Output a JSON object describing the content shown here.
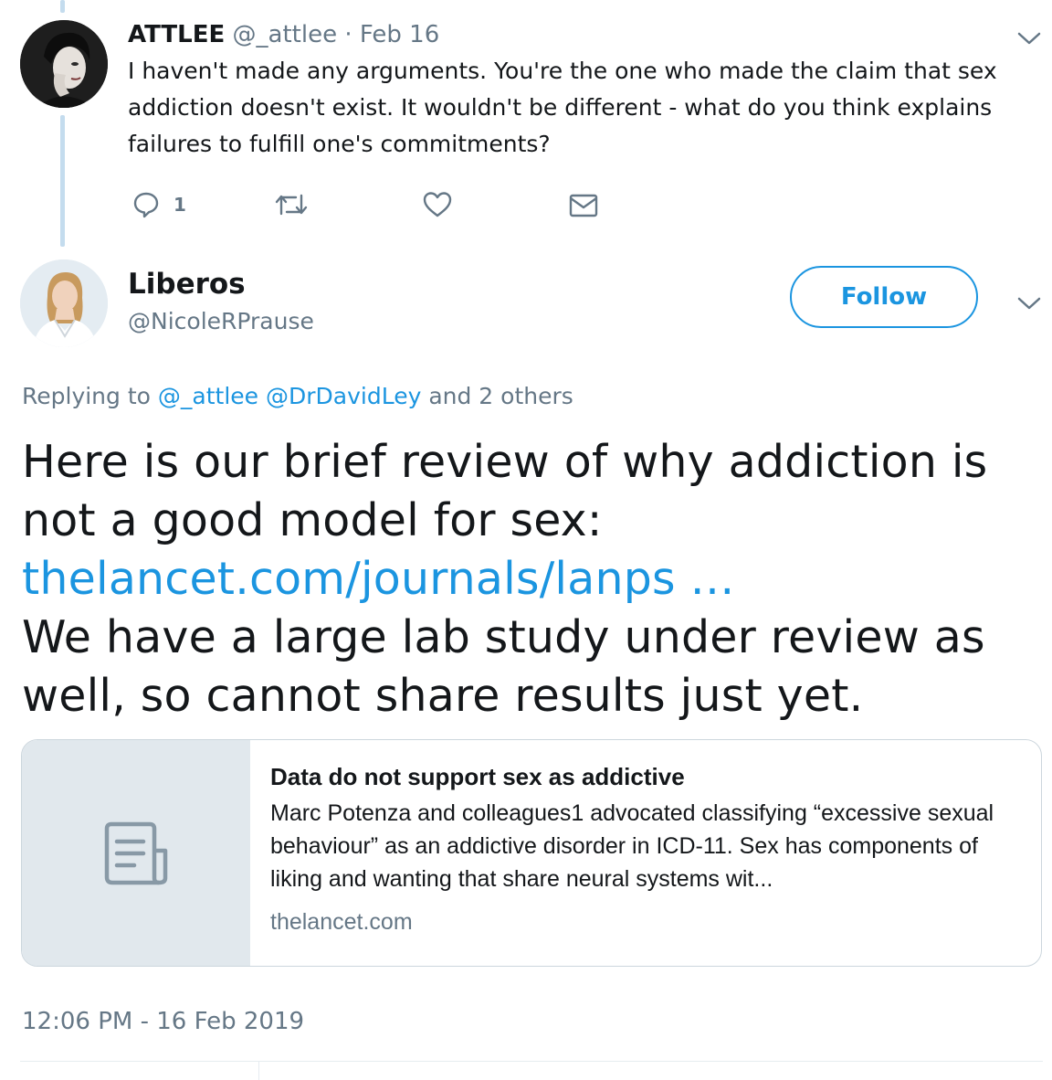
{
  "reply_tweet": {
    "author_name": "ATTLEE",
    "author_handle": "@_attlee",
    "date": "· Feb 16",
    "text": "I haven't made any arguments. You're the one who made the claim that sex addiction doesn't exist. It wouldn't be different - what do you think explains failures to fulfill one's commitments?",
    "reply_count": "1"
  },
  "main_tweet": {
    "author_name": "Liberos",
    "author_handle": "@NicoleRPrause",
    "follow_label": "Follow",
    "replying_prefix": "Replying to",
    "replying_mention_1": "@_attlee",
    "replying_mention_2": "@DrDavidLey",
    "replying_suffix": "and 2 others",
    "text_part_1": "Here is our brief review of why addiction is not a good model for sex:",
    "link": "thelancet.com/journals/lanps",
    "link_ellipsis": " …",
    "text_part_2": "We have a large lab study under review as well, so cannot share results just yet.",
    "card": {
      "title": "Data do not support sex as addictive",
      "description": "Marc Potenza and colleagues1 advocated classifying “excessive sexual behaviour” as an addictive disorder in ICD-11. Sex has components of liking and wanting that share neural systems wit...",
      "domain": "thelancet.com"
    },
    "timestamp": "12:06 PM - 16 Feb 2019"
  },
  "colors": {
    "accent": "#1b95e0",
    "secondary_text": "#657786",
    "thread_line": "#c4dcee",
    "card_thumb_bg": "#e1e8ed"
  }
}
